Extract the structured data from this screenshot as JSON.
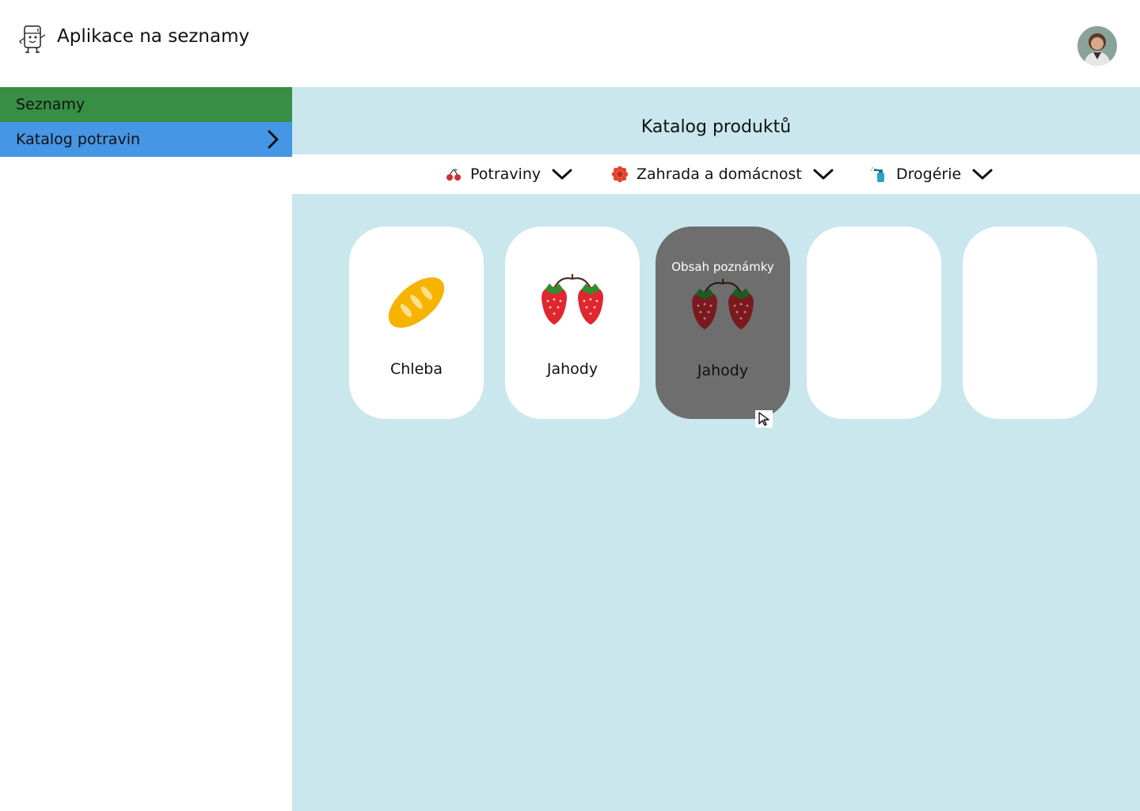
{
  "header": {
    "app_title": "Aplikace na seznamy",
    "logo_icon": "fridge-mascot-icon",
    "avatar_icon": "user-avatar"
  },
  "sidebar": {
    "items": [
      {
        "label": "Seznamy",
        "color": "#388e45",
        "active": false
      },
      {
        "label": "Katalog potravin",
        "color": "#4596e5",
        "active": true,
        "icon": "chevron-right-icon"
      }
    ]
  },
  "main": {
    "title": "Katalog produktů",
    "background": "#c9e7ec",
    "filters": [
      {
        "label": "Potraviny",
        "icon": "cherries-icon"
      },
      {
        "label": "Zahrada a domácnost",
        "icon": "flower-icon"
      },
      {
        "label": "Drogérie",
        "icon": "spray-bottle-icon"
      }
    ],
    "products": [
      {
        "label": "Chleba",
        "icon": "bread-icon",
        "hovered": false
      },
      {
        "label": "Jahody",
        "icon": "strawberries-icon",
        "hovered": false
      },
      {
        "label": "Jahody",
        "icon": "strawberries-icon",
        "hovered": true,
        "note": "Obsah poznámky"
      },
      {
        "label": "",
        "icon": "",
        "hovered": false
      },
      {
        "label": "",
        "icon": "",
        "hovered": false
      }
    ]
  }
}
